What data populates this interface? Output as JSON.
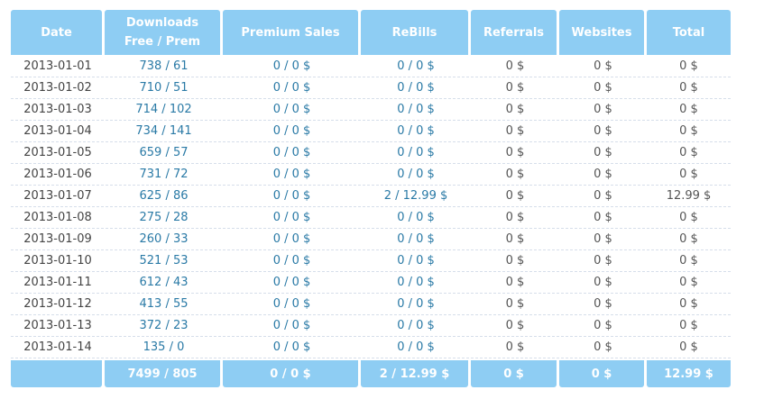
{
  "headers": [
    "Date",
    "Downloads\nFree / Prem",
    "Premium Sales",
    "ReBills",
    "Referrals",
    "Websites",
    "Total"
  ],
  "rows": [
    [
      "2013-01-01",
      "738 / 61",
      "0 / 0 $",
      "0 / 0 $",
      "0 $",
      "0 $",
      "0 $"
    ],
    [
      "2013-01-02",
      "710 / 51",
      "0 / 0 $",
      "0 / 0 $",
      "0 $",
      "0 $",
      "0 $"
    ],
    [
      "2013-01-03",
      "714 / 102",
      "0 / 0 $",
      "0 / 0 $",
      "0 $",
      "0 $",
      "0 $"
    ],
    [
      "2013-01-04",
      "734 / 141",
      "0 / 0 $",
      "0 / 0 $",
      "0 $",
      "0 $",
      "0 $"
    ],
    [
      "2013-01-05",
      "659 / 57",
      "0 / 0 $",
      "0 / 0 $",
      "0 $",
      "0 $",
      "0 $"
    ],
    [
      "2013-01-06",
      "731 / 72",
      "0 / 0 $",
      "0 / 0 $",
      "0 $",
      "0 $",
      "0 $"
    ],
    [
      "2013-01-07",
      "625 / 86",
      "0 / 0 $",
      "2 / 12.99 $",
      "0 $",
      "0 $",
      "12.99 $"
    ],
    [
      "2013-01-08",
      "275 / 28",
      "0 / 0 $",
      "0 / 0 $",
      "0 $",
      "0 $",
      "0 $"
    ],
    [
      "2013-01-09",
      "260 / 33",
      "0 / 0 $",
      "0 / 0 $",
      "0 $",
      "0 $",
      "0 $"
    ],
    [
      "2013-01-10",
      "521 / 53",
      "0 / 0 $",
      "0 / 0 $",
      "0 $",
      "0 $",
      "0 $"
    ],
    [
      "2013-01-11",
      "612 / 43",
      "0 / 0 $",
      "0 / 0 $",
      "0 $",
      "0 $",
      "0 $"
    ],
    [
      "2013-01-12",
      "413 / 55",
      "0 / 0 $",
      "0 / 0 $",
      "0 $",
      "0 $",
      "0 $"
    ],
    [
      "2013-01-13",
      "372 / 23",
      "0 / 0 $",
      "0 / 0 $",
      "0 $",
      "0 $",
      "0 $"
    ],
    [
      "2013-01-14",
      "135 / 0",
      "0 / 0 $",
      "0 / 0 $",
      "0 $",
      "0 $",
      "0 $"
    ]
  ],
  "totals": [
    "",
    "7499 / 805",
    "0 / 0 $",
    "2 / 12.99 $",
    "0 $",
    "0 $",
    "12.99 $"
  ],
  "colors": {
    "header_bg": "#8ecdf3",
    "header_text": "#ffffff",
    "value_text": "#2a7aa6",
    "date_text": "#444444"
  }
}
